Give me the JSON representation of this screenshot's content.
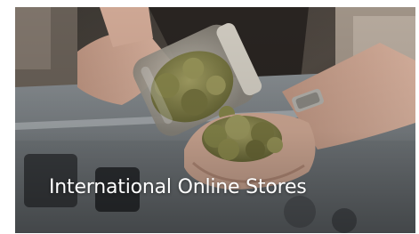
{
  "card": {
    "title": "International Online Stores"
  },
  "photo": {
    "icon": "cannabis-jar-photo"
  },
  "colors": {
    "title_text": "#ffffff",
    "bud_green": "#8a8a4c",
    "jar_glass": "#b9b4a8",
    "skin": "#d2a892"
  }
}
